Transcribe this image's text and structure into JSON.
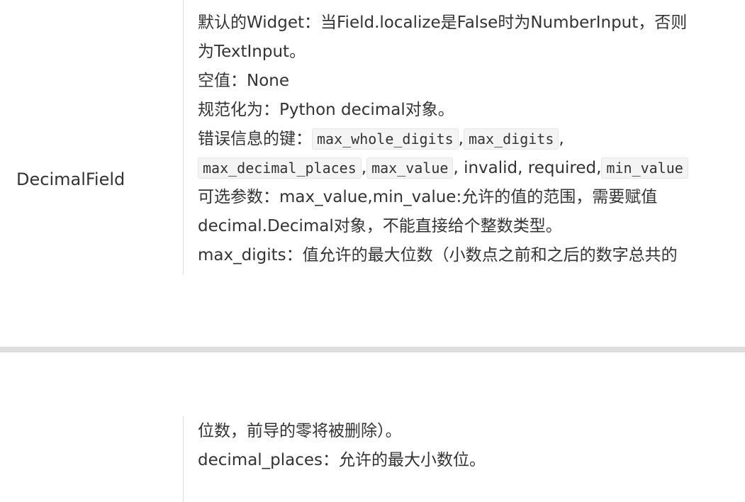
{
  "row": {
    "field_name": "DecimalField",
    "default_widget": "默认的Widget：当Field.localize是False时为NumberInput，否则",
    "default_widget_cont": "为TextInput。",
    "empty_value": "空值：None",
    "normalizes_to": "规范化为：Python decimal对象。",
    "error_keys_label": "错误信息的键：",
    "error_keys": [
      "max_whole_digits",
      "max_digits",
      "max_decimal_places",
      "max_value",
      "min_value"
    ],
    "error_plain_1": "invalid, required,",
    "optional_args_1": "可选参数：max_value,min_value:允许的值的范围，需要赋值",
    "optional_args_2": "decimal.Decimal对象，不能直接给个整数类型。",
    "max_digits_desc": "max_digits：值允许的最大位数（小数点之前和之后的数字总共的",
    "max_digits_desc_cont": "位数，前导的零将被删除）。",
    "decimal_places_desc": "decimal_places：允许的最大小数位。"
  }
}
